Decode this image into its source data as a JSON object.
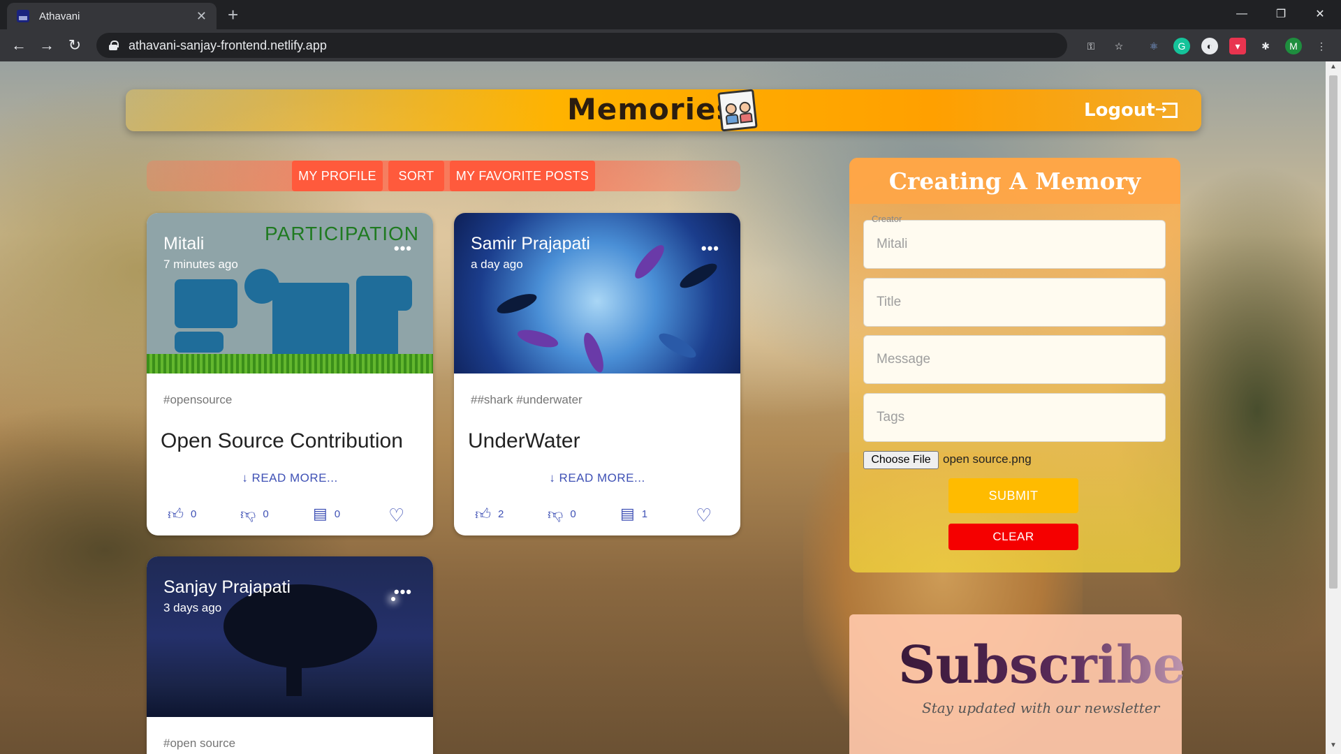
{
  "browser": {
    "tab_title": "Athavani",
    "url": "athavani-sanjay-frontend.netlify.app",
    "profile_initial": "M"
  },
  "app": {
    "brand": "Memories",
    "logout_label": "Logout"
  },
  "nav": {
    "my_profile": "MY PROFILE",
    "sort": "SORT",
    "favorites": "MY FAVORITE POSTS"
  },
  "posts": [
    {
      "creator": "Mitali",
      "time": "7 minutes ago",
      "image_word": "PARTICIPATION",
      "tags": "#opensource",
      "title": "Open Source Contribution",
      "read_more": "READ MORE...",
      "likes": "0",
      "dislikes": "0",
      "comments": "0"
    },
    {
      "creator": "Samir Prajapati",
      "time": "a day ago",
      "tags": "##shark #underwater",
      "title": "UnderWater",
      "read_more": "READ MORE...",
      "likes": "2",
      "dislikes": "0",
      "comments": "1"
    },
    {
      "creator": "Sanjay Prajapati",
      "time": "3 days ago",
      "tags": "#open source"
    }
  ],
  "form": {
    "heading": "Creating A Memory",
    "creator_label": "Creator",
    "creator_value": "Mitali",
    "title_placeholder": "Title",
    "message_placeholder": "Message",
    "tags_placeholder": "Tags",
    "choose_file": "Choose File",
    "file_name": "open source.png",
    "submit": "SUBMIT",
    "clear": "CLEAR"
  },
  "subscribe": {
    "heading": "Subscribe",
    "subtitle": "Stay updated with our newsletter"
  },
  "colors": {
    "accent_orange": "#ffa000",
    "nav_button": "#ff5a3c",
    "submit": "#ffbb00",
    "clear": "#f50000",
    "action_icon": "#3f51b5"
  }
}
